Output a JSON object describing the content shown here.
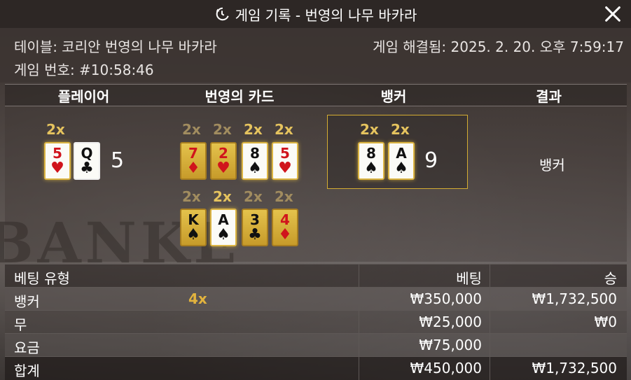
{
  "window": {
    "title": "게임 기록 - 번영의 나무 바카라",
    "history_icon": "history-icon",
    "close_icon": "close-icon"
  },
  "info": {
    "table": "테이블: 코리안 번영의 나무 바카라",
    "game_number": "게임 번호: #10:58:46",
    "resolved": "게임 해결됨: 2025. 2. 20. 오후 7:59:17"
  },
  "headers": {
    "player": "플레이어",
    "fortune_cards": "번영의 카드",
    "banker": "뱅커",
    "result": "결과"
  },
  "player": {
    "total": "5",
    "cards": [
      {
        "rank": "5",
        "suit": "♥",
        "mult": "2x"
      },
      {
        "rank": "Q",
        "suit": "♣"
      }
    ]
  },
  "fortune_cards": {
    "row1": [
      {
        "rank": "7",
        "suit": "♦",
        "mult": "2x"
      },
      {
        "rank": "2",
        "suit": "♥",
        "mult": "2x"
      },
      {
        "rank": "8",
        "suit": "♠",
        "mult": "2x"
      },
      {
        "rank": "5",
        "suit": "♥",
        "mult": "2x"
      }
    ],
    "row2": [
      {
        "rank": "K",
        "suit": "♠",
        "mult": "2x"
      },
      {
        "rank": "A",
        "suit": "♠",
        "mult": "2x"
      },
      {
        "rank": "3",
        "suit": "♣",
        "mult": "2x"
      },
      {
        "rank": "4",
        "suit": "♦",
        "mult": "2x"
      }
    ]
  },
  "banker": {
    "total": "9",
    "cards": [
      {
        "rank": "8",
        "suit": "♠",
        "mult": "2x"
      },
      {
        "rank": "A",
        "suit": "♠",
        "mult": "2x"
      }
    ]
  },
  "result": "뱅커",
  "bets": {
    "headers": {
      "type": "베팅 유형",
      "bet": "베팅",
      "win": "승"
    },
    "rows": [
      {
        "type": "뱅커",
        "mult": "4x",
        "bet": "₩350,000",
        "win": "₩1,732,500"
      },
      {
        "type": "무",
        "bet": "₩25,000",
        "win": "₩0"
      },
      {
        "type": "요금",
        "bet": "₩75,000",
        "win": ""
      },
      {
        "type": "합계",
        "bet": "₩450,000",
        "win": "₩1,732,500"
      }
    ]
  },
  "background_word": "BANKE",
  "colors": {
    "accent_gold": "#d4ad32",
    "card_red": "#d0141c"
  }
}
